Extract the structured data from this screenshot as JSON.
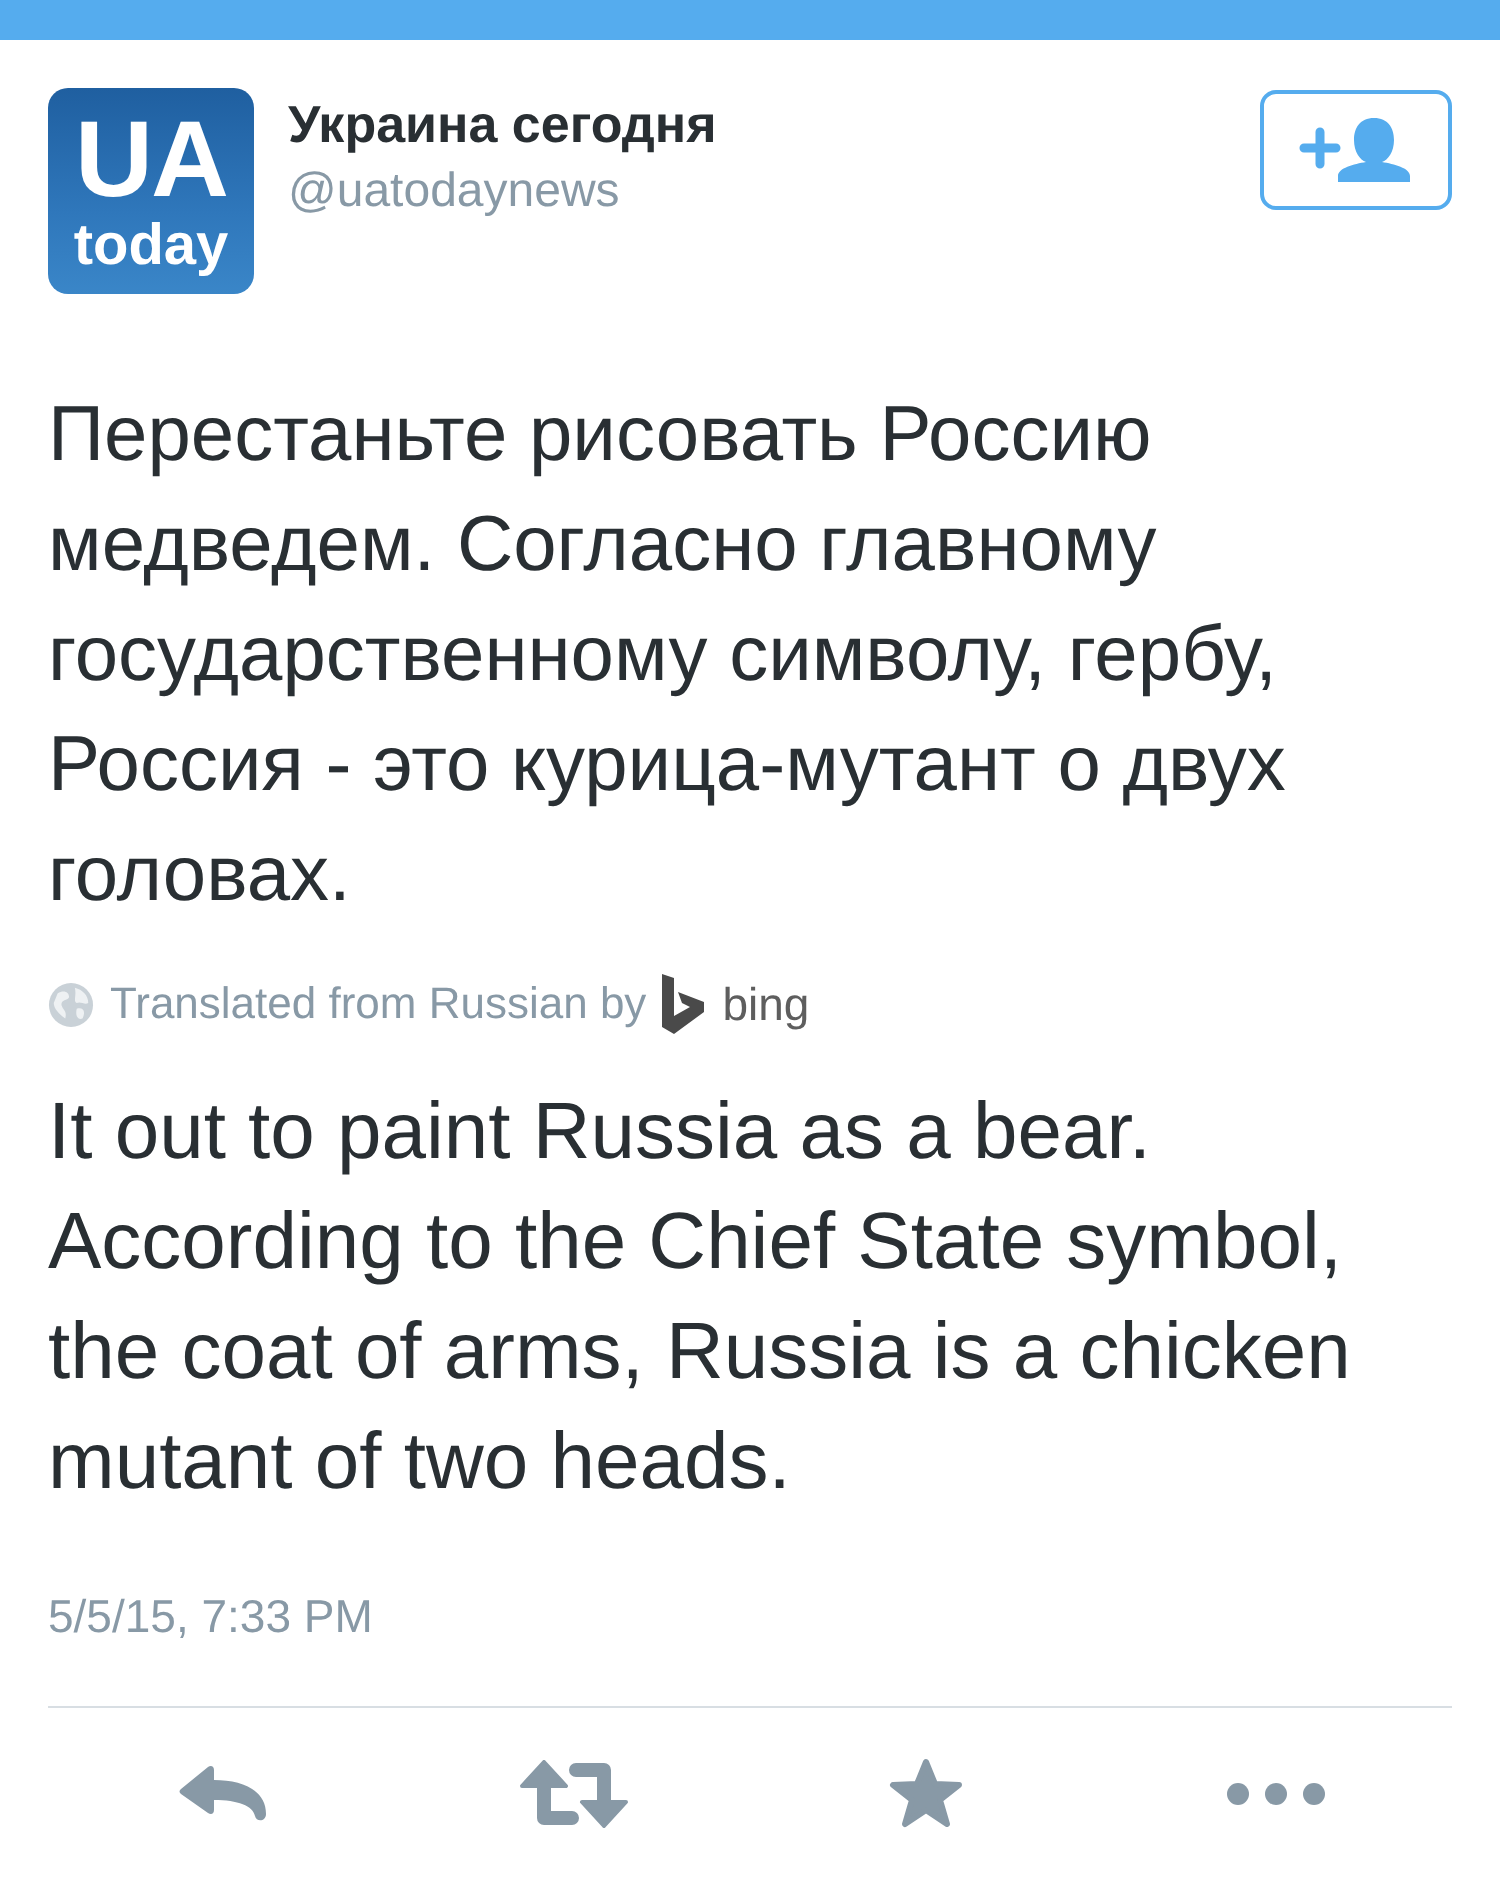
{
  "tweet": {
    "avatar": {
      "line_1": "UA",
      "line_2": "today"
    },
    "author": {
      "name": "Украина сегодня",
      "handle": "@uatodaynews"
    },
    "text": "Перестаньте рисовать Россию медведем. Согласно главному государственному символу, гербу, Россия - это курица-мутант о двух головах.",
    "translation": {
      "label": "Translated from Russian by",
      "provider": "bing",
      "text": "It out to paint Russia as a bear. According to the Chief State symbol, the coat of arms, Russia is a chicken mutant of two heads."
    },
    "timestamp": "5/5/15, 7:33 PM",
    "actions": [
      {
        "kind": "reply"
      },
      {
        "kind": "retweet"
      },
      {
        "kind": "favorite"
      },
      {
        "kind": "more"
      }
    ]
  }
}
